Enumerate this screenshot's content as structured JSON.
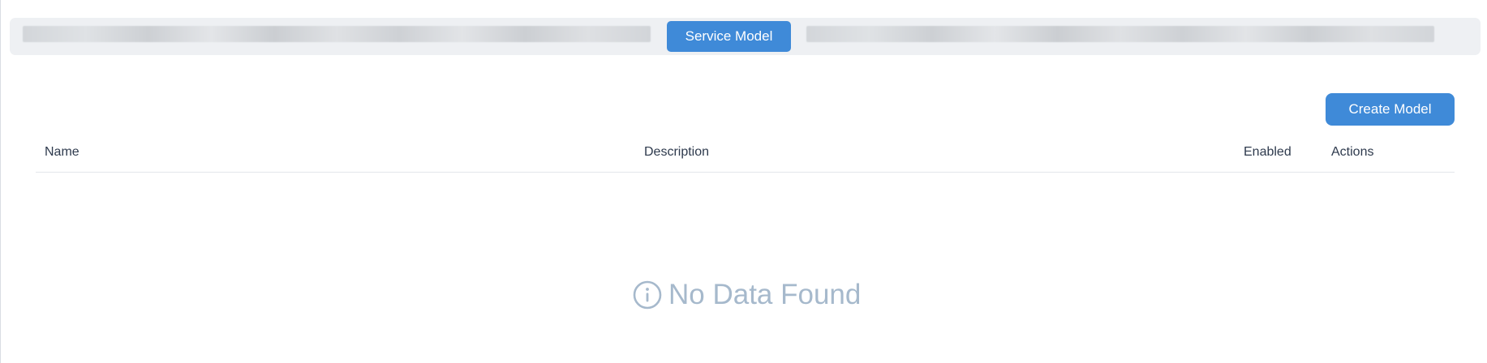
{
  "tabs": {
    "active_label": "Service Model"
  },
  "toolbar": {
    "create_label": "Create Model"
  },
  "table": {
    "columns": [
      "Name",
      "Description",
      "Enabled",
      "Actions"
    ],
    "rows": []
  },
  "empty_state": {
    "message": "No Data Found",
    "icon": "info-circle-icon"
  },
  "colors": {
    "accent": "#3f8ad8",
    "tab_bar_bg": "#eef0f3",
    "empty_text": "#a6b9cc"
  }
}
